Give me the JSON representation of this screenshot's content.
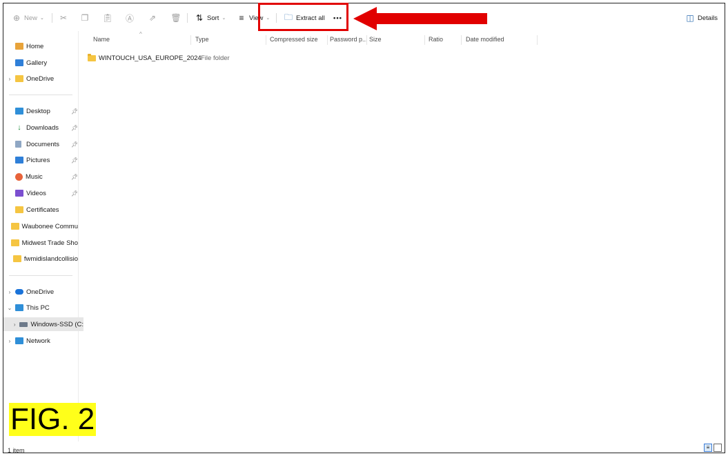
{
  "toolbar": {
    "new_label": "New",
    "sort_label": "Sort",
    "view_label": "View",
    "extract_label": "Extract all",
    "more_label": "•••",
    "details_label": "Details"
  },
  "sidebar": {
    "home": "Home",
    "gallery": "Gallery",
    "onedrive_top": "OneDrive",
    "quick": [
      "Desktop",
      "Downloads",
      "Documents",
      "Pictures",
      "Music",
      "Videos"
    ],
    "folders": [
      "Certificates",
      "Waubonee Commu",
      "Midwest Trade Sho",
      "fwmidislandcollisio"
    ],
    "onedrive": "OneDrive",
    "thispc": "This PC",
    "drive": "Windows-SSD (C:",
    "network": "Network"
  },
  "columns": {
    "name": "Name",
    "type": "Type",
    "compressed": "Compressed size",
    "password": "Password p...",
    "size": "Size",
    "ratio": "Ratio",
    "date": "Date modified"
  },
  "files": [
    {
      "name": "WINTOUCH_USA_EUROPE_2024",
      "type": "File folder"
    }
  ],
  "status": {
    "count": "1 item"
  },
  "annotation": {
    "figure_label": "FIG. 2"
  },
  "colors": {
    "highlight_red": "#e10000",
    "label_yellow": "#ffff1a",
    "folder_yellow": "#f5c542"
  }
}
